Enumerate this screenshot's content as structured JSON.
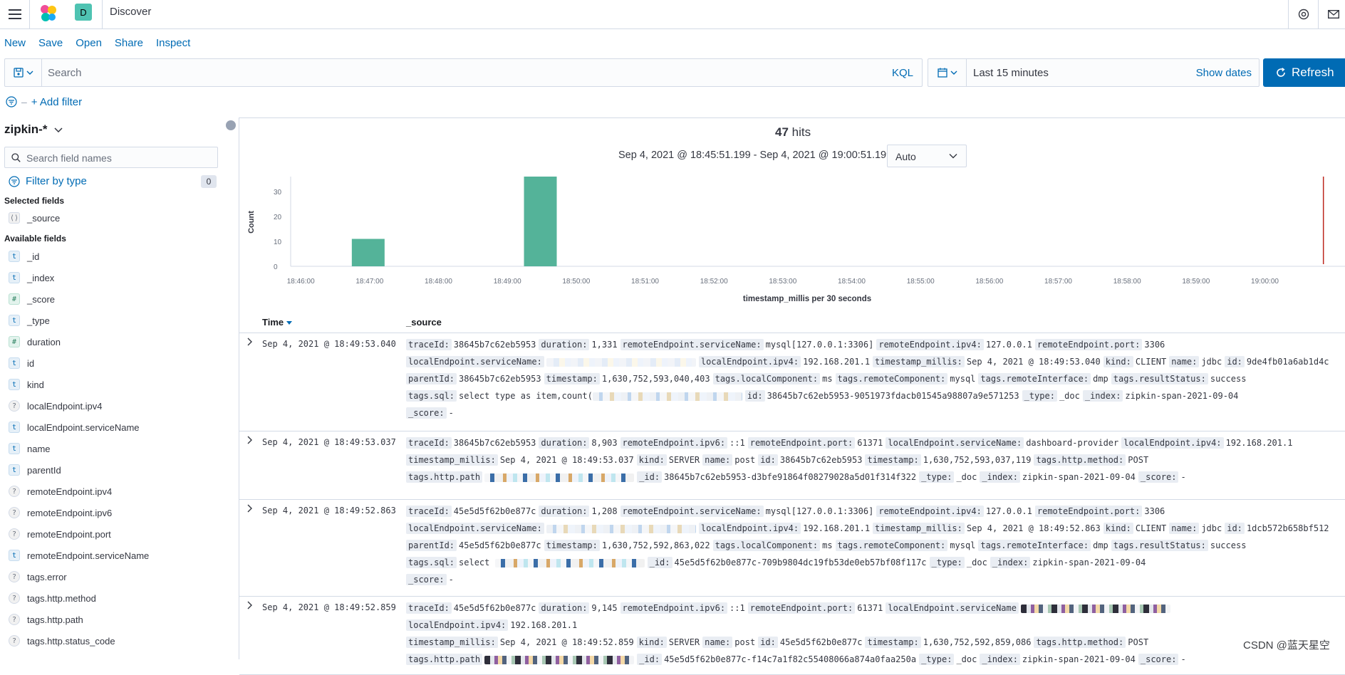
{
  "header": {
    "space_initial": "D",
    "breadcrumb": "Discover"
  },
  "topnav": [
    "New",
    "Save",
    "Open",
    "Share",
    "Inspect"
  ],
  "query": {
    "placeholder": "Search",
    "language": "KQL"
  },
  "time": {
    "range": "Last 15 minutes",
    "show_dates": "Show dates",
    "refresh": "Refresh"
  },
  "filters": {
    "add_label": "+ Add filter"
  },
  "sidebar": {
    "index_pattern": "zipkin-*",
    "search_placeholder": "Search field names",
    "filter_by_type": "Filter by type",
    "filter_count": "0",
    "selected_title": "Selected fields",
    "selected": [
      {
        "type": "s",
        "name": "_source"
      }
    ],
    "available_title": "Available fields",
    "available": [
      {
        "type": "t",
        "name": "_id"
      },
      {
        "type": "t",
        "name": "_index"
      },
      {
        "type": "#",
        "name": "_score"
      },
      {
        "type": "t",
        "name": "_type"
      },
      {
        "type": "#",
        "name": "duration"
      },
      {
        "type": "t",
        "name": "id"
      },
      {
        "type": "t",
        "name": "kind"
      },
      {
        "type": "?",
        "name": "localEndpoint.ipv4"
      },
      {
        "type": "t",
        "name": "localEndpoint.serviceName"
      },
      {
        "type": "t",
        "name": "name"
      },
      {
        "type": "t",
        "name": "parentId"
      },
      {
        "type": "?",
        "name": "remoteEndpoint.ipv4"
      },
      {
        "type": "?",
        "name": "remoteEndpoint.ipv6"
      },
      {
        "type": "?",
        "name": "remoteEndpoint.port"
      },
      {
        "type": "t",
        "name": "remoteEndpoint.serviceName"
      },
      {
        "type": "?",
        "name": "tags.error"
      },
      {
        "type": "?",
        "name": "tags.http.method"
      },
      {
        "type": "?",
        "name": "tags.http.path"
      },
      {
        "type": "?",
        "name": "tags.http.status_code"
      }
    ]
  },
  "histogram": {
    "hits_count": "47",
    "hits_label": "hits",
    "time_range": "Sep 4, 2021 @ 18:45:51.199 - Sep 4, 2021 @ 19:00:51.199",
    "interval": "Auto"
  },
  "chart_data": {
    "type": "bar",
    "xlabel": "timestamp_millis per 30 seconds",
    "ylabel": "Count",
    "ylim": [
      0,
      36
    ],
    "yticks": [
      0,
      10,
      20,
      30
    ],
    "x_ticks": [
      "18:46:00",
      "18:47:00",
      "18:48:00",
      "18:49:00",
      "18:50:00",
      "18:51:00",
      "18:52:00",
      "18:53:00",
      "18:54:00",
      "18:55:00",
      "18:56:00",
      "18:57:00",
      "18:58:00",
      "18:59:00",
      "19:00:00"
    ],
    "bars": [
      {
        "x": "18:47:00",
        "value": 11
      },
      {
        "x": "18:49:30",
        "value": 36
      }
    ],
    "bar_color": "#54b399",
    "now_marker": "19:00:51"
  },
  "table": {
    "col_time": "Time",
    "col_source": "_source",
    "rows": [
      {
        "time": "Sep 4, 2021 @ 18:49:53.040",
        "lines": [
          [
            [
              "traceId:",
              "38645b7c62eb5953"
            ],
            [
              "duration:",
              "1,331"
            ],
            [
              "remoteEndpoint.serviceName:",
              "mysql[127.0.0.1:3306]"
            ],
            [
              "remoteEndpoint.ipv4:",
              "127.0.0.1"
            ],
            [
              "remoteEndpoint.port:",
              "3306"
            ]
          ],
          [
            [
              "localEndpoint.serviceName:",
              "#blur"
            ],
            [
              "localEndpoint.ipv4:",
              "192.168.201.1"
            ],
            [
              "timestamp_millis:",
              "Sep 4, 2021 @ 18:49:53.040"
            ],
            [
              "kind:",
              "CLIENT"
            ],
            [
              "name:",
              "jdbc"
            ],
            [
              "id:",
              "9de4fb01a6ab1d4c"
            ]
          ],
          [
            [
              "parentId:",
              "38645b7c62eb5953"
            ],
            [
              "timestamp:",
              "1,630,752,593,040,403"
            ],
            [
              "tags.localComponent:",
              "ms"
            ],
            [
              "tags.remoteComponent:",
              "mysql"
            ],
            [
              "tags.remoteInterface:",
              "dmp"
            ],
            [
              "tags.resultStatus:",
              "success"
            ]
          ],
          [
            [
              "tags.sql:",
              "select type as item,count(#blur1"
            ],
            [
              "id:",
              "38645b7c62eb5953-9051973fdacb01545a98807a9e571253"
            ],
            [
              "_type:",
              "_doc"
            ],
            [
              "_index:",
              "zipkin-span-2021-09-04"
            ]
          ],
          [
            [
              "_score:",
              "-"
            ]
          ]
        ]
      },
      {
        "time": "Sep 4, 2021 @ 18:49:53.037",
        "lines": [
          [
            [
              "traceId:",
              "38645b7c62eb5953"
            ],
            [
              "duration:",
              "8,903"
            ],
            [
              "remoteEndpoint.ipv6:",
              "::1"
            ],
            [
              "remoteEndpoint.port:",
              "61371"
            ],
            [
              "localEndpoint.serviceName:",
              "dashboard-provider"
            ],
            [
              "localEndpoint.ipv4:",
              "192.168.201.1"
            ]
          ],
          [
            [
              "timestamp_millis:",
              "Sep 4, 2021 @ 18:49:53.037"
            ],
            [
              "kind:",
              "SERVER"
            ],
            [
              "name:",
              "post"
            ],
            [
              "id:",
              "38645b7c62eb5953"
            ],
            [
              "timestamp:",
              "1,630,752,593,037,119"
            ],
            [
              "tags.http.method:",
              "POST"
            ]
          ],
          [
            [
              "tags.http.path",
              "#blur2"
            ],
            [
              "_id:",
              "38645b7c62eb5953-d3bfe91864f08279028a5d01f314f322"
            ],
            [
              "_type:",
              "_doc"
            ],
            [
              "_index:",
              "zipkin-span-2021-09-04"
            ],
            [
              "_score:",
              "-"
            ]
          ]
        ]
      },
      {
        "time": "Sep 4, 2021 @ 18:49:52.863",
        "lines": [
          [
            [
              "traceId:",
              "45e5d5f62b0e877c"
            ],
            [
              "duration:",
              "1,208"
            ],
            [
              "remoteEndpoint.serviceName:",
              "mysql[127.0.0.1:3306]"
            ],
            [
              "remoteEndpoint.ipv4:",
              "127.0.0.1"
            ],
            [
              "remoteEndpoint.port:",
              "3306"
            ]
          ],
          [
            [
              "localEndpoint.serviceName:",
              "#blur1"
            ],
            [
              "localEndpoint.ipv4:",
              "192.168.201.1"
            ],
            [
              "timestamp_millis:",
              "Sep 4, 2021 @ 18:49:52.863"
            ],
            [
              "kind:",
              "CLIENT"
            ],
            [
              "name:",
              "jdbc"
            ],
            [
              "id:",
              "1dcb572b658bf512"
            ]
          ],
          [
            [
              "parentId:",
              "45e5d5f62b0e877c"
            ],
            [
              "timestamp:",
              "1,630,752,592,863,022"
            ],
            [
              "tags.localComponent:",
              "ms"
            ],
            [
              "tags.remoteComponent:",
              "mysql"
            ],
            [
              "tags.remoteInterface:",
              "dmp"
            ],
            [
              "tags.resultStatus:",
              "success"
            ]
          ],
          [
            [
              "tags.sql:",
              "select #blur2"
            ],
            [
              "_id:",
              "45e5d5f62b0e877c-709b9804dc19fb53de0eb57bf08f117c"
            ],
            [
              "_type:",
              "_doc"
            ],
            [
              "_index:",
              "zipkin-span-2021-09-04"
            ]
          ],
          [
            [
              "_score:",
              "-"
            ]
          ]
        ]
      },
      {
        "time": "Sep 4, 2021 @ 18:49:52.859",
        "lines": [
          [
            [
              "traceId:",
              "45e5d5f62b0e877c"
            ],
            [
              "duration:",
              "9,145"
            ],
            [
              "remoteEndpoint.ipv6:",
              "::1"
            ],
            [
              "remoteEndpoint.port:",
              "61371"
            ],
            [
              "localEndpoint.serviceName",
              "#blur3"
            ],
            [
              "localEndpoint.ipv4:",
              "192.168.201.1"
            ]
          ],
          [
            [
              "timestamp_millis:",
              "Sep 4, 2021 @ 18:49:52.859"
            ],
            [
              "kind:",
              "SERVER"
            ],
            [
              "name:",
              "post"
            ],
            [
              "id:",
              "45e5d5f62b0e877c"
            ],
            [
              "timestamp:",
              "1,630,752,592,859,086"
            ],
            [
              "tags.http.method:",
              "POST"
            ]
          ],
          [
            [
              "tags.http.path",
              "#blur3"
            ],
            [
              "_id:",
              "45e5d5f62b0e877c-f14c7a1f82c55408066a874a0faa250a"
            ],
            [
              "_type:",
              "_doc"
            ],
            [
              "_index:",
              "zipkin-span-2021-09-04"
            ],
            [
              "_score:",
              "-"
            ]
          ]
        ]
      }
    ]
  },
  "watermark": "CSDN @蓝天星空"
}
